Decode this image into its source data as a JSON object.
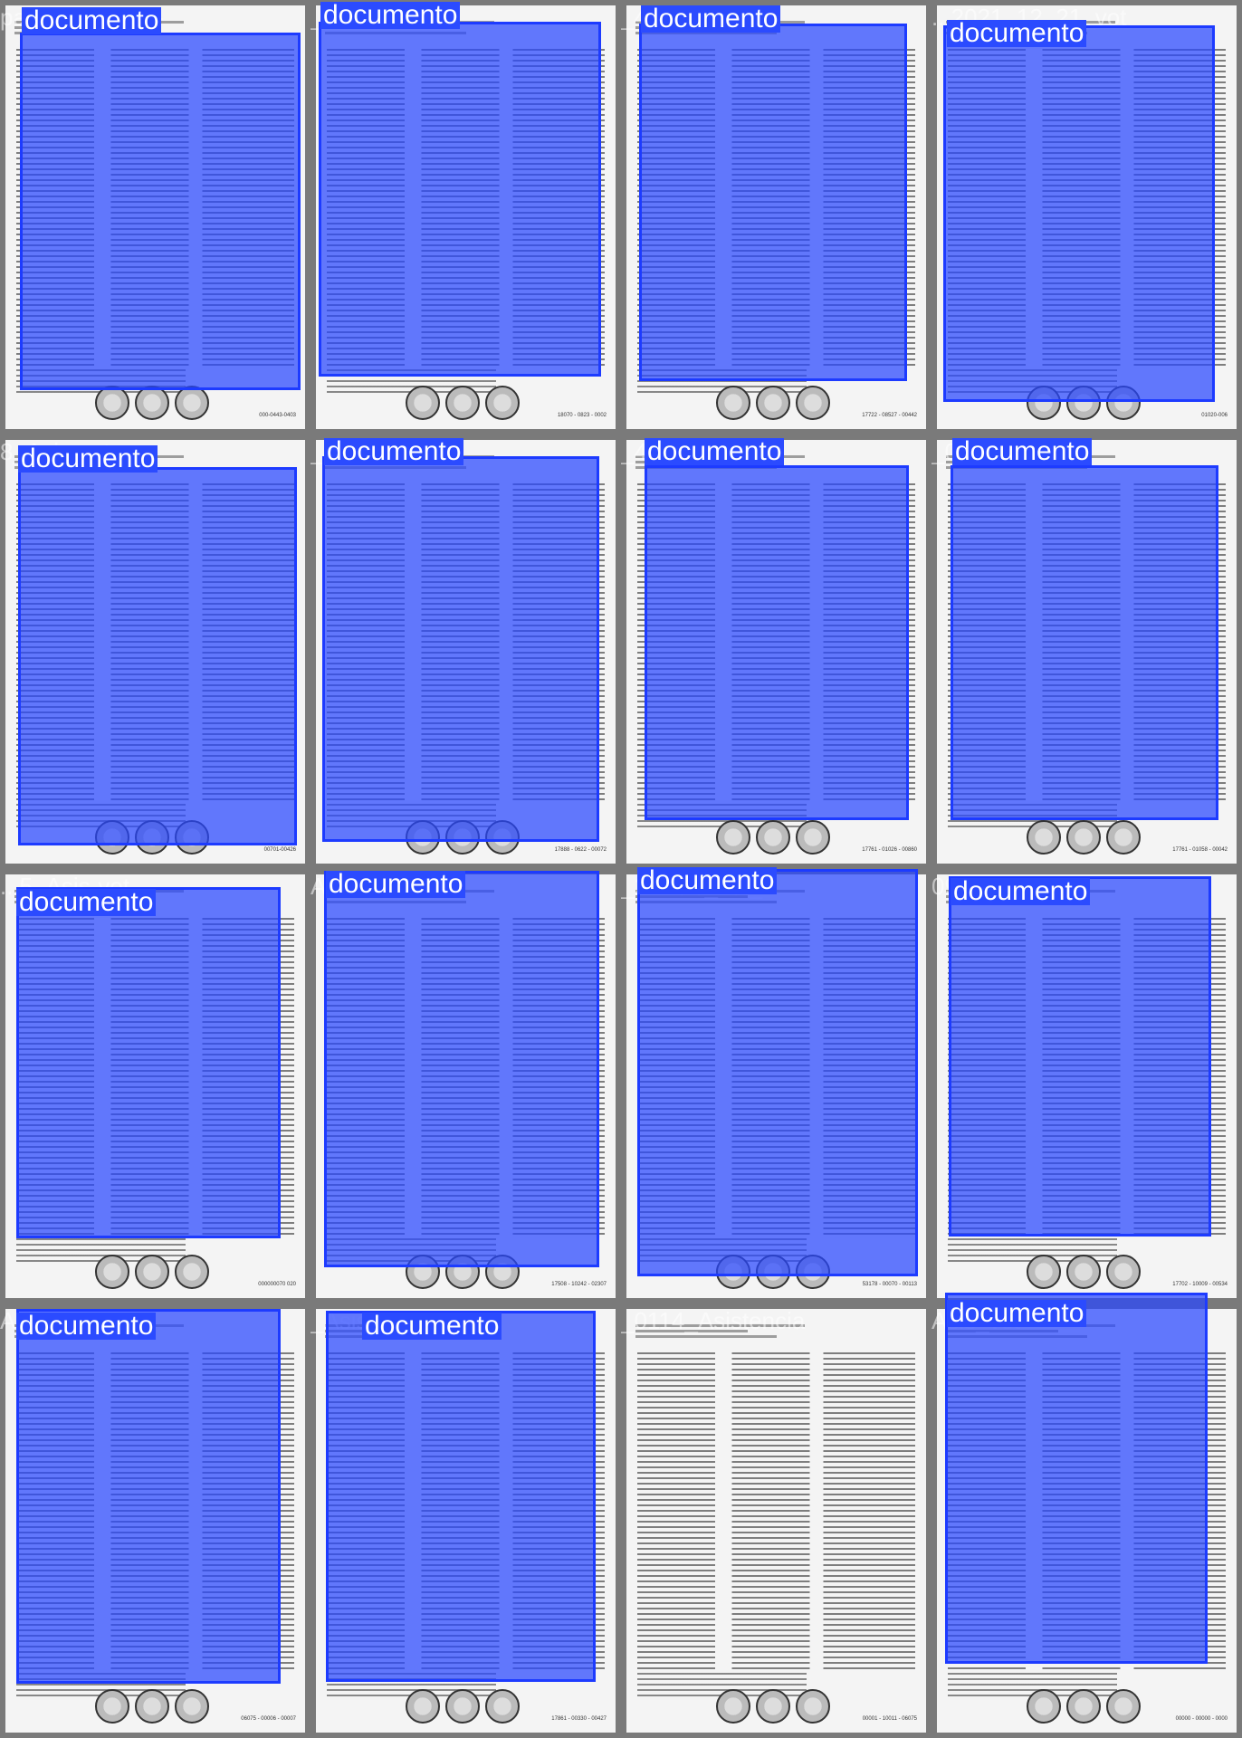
{
  "overlay_label": "documento",
  "colors": {
    "overlay_fill": "#3a5cff",
    "overlay_border": "#1d3bff",
    "label_bg": "#2b4bff",
    "label_text": "#ffffff",
    "background": "#6e6e6e"
  },
  "tiles": [
    {
      "title": "pa...6_Asis-vot-",
      "ref": "000-0443-0403",
      "detected": true
    },
    {
      "title": "_25Asisvot9",
      "ref": "18070 - 0823 - 0002",
      "detected": true
    },
    {
      "title": "_40Asis-voi-",
      "ref": "17722 - 08527 - 00442",
      "detected": true
    },
    {
      "title": "...2021_12_21_vot",
      "ref": "01020-006",
      "detected": true
    },
    {
      "title": "8_Asis-vot-",
      "ref": "00701-00426",
      "detected": true
    },
    {
      "title": "_25Asisvot",
      "ref": "17888 - 0622 - 00072",
      "detected": true
    },
    {
      "title": "_40Asis-vot-",
      "ref": "17761 - 01026 - 00860",
      "detected": true
    },
    {
      "title": "_07Asis_vot_",
      "ref": "17761 - 01058 - 00042",
      "detected": true
    },
    {
      "title": "...5_Asis-vot-",
      "ref": "000000070 020",
      "detected": true
    },
    {
      "title": "Asisvot",
      "ref": "17508 - 10242 - 02307",
      "detected": true
    },
    {
      "title": "_21Asis_vot_",
      "ref": "53178 - 00070 - 00113",
      "detected": true
    },
    {
      "title": "09-22-05",
      "ref": "17702 - 10009 - 00534",
      "detected": true
    },
    {
      "title": "Asis_vot_0",
      "ref": "06075 - 00006 - 00007",
      "detected": true
    },
    {
      "title": "_Asis-vot-",
      "ref": "17861 - 00330 - 00427",
      "detected": true
    },
    {
      "title": "_0114_Asistencia",
      "ref": "00001 - 10011 - 06075",
      "detected": false
    },
    {
      "title": "Asis_vot",
      "ref": "00000 - 00000 - 0000",
      "detected": true
    }
  ]
}
